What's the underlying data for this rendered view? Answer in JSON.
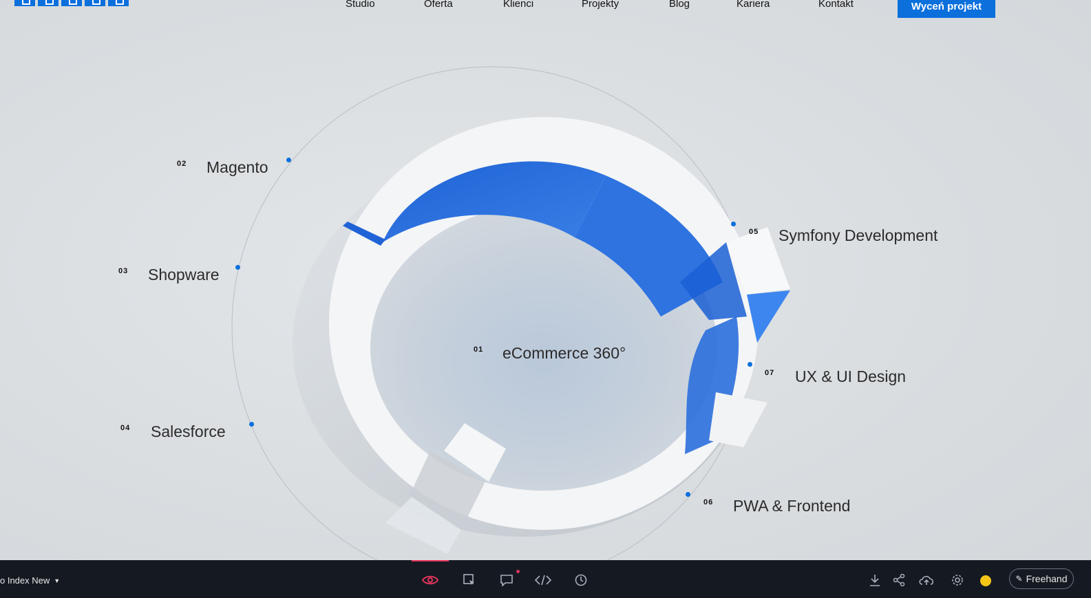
{
  "nav": {
    "items": [
      "Studio",
      "Oferta",
      "Klienci",
      "Projekty",
      "Blog",
      "Kariera",
      "Kontakt"
    ],
    "cta": "Wyceń projekt"
  },
  "services": [
    {
      "num": "01",
      "label": "eCommerce 360°"
    },
    {
      "num": "02",
      "label": "Magento"
    },
    {
      "num": "03",
      "label": "Shopware"
    },
    {
      "num": "04",
      "label": "Salesforce"
    },
    {
      "num": "05",
      "label": "Symfony Development"
    },
    {
      "num": "06",
      "label": "PWA & Frontend"
    },
    {
      "num": "07",
      "label": "UX & UI Design"
    }
  ],
  "toolbar": {
    "project_label": "o Index New",
    "freehand_label": "Freehand",
    "icons": [
      "preview-eye-icon",
      "inspect-cursor-icon",
      "comment-icon",
      "code-icon",
      "history-clock-icon",
      "download-icon",
      "share-icon",
      "cloud-upload-icon",
      "settings-gear-icon"
    ]
  },
  "colors": {
    "accent": "#0b6fdc",
    "toolbar_bg": "#151a22",
    "active_indicator": "#e0335a",
    "status": "#f5c518"
  }
}
